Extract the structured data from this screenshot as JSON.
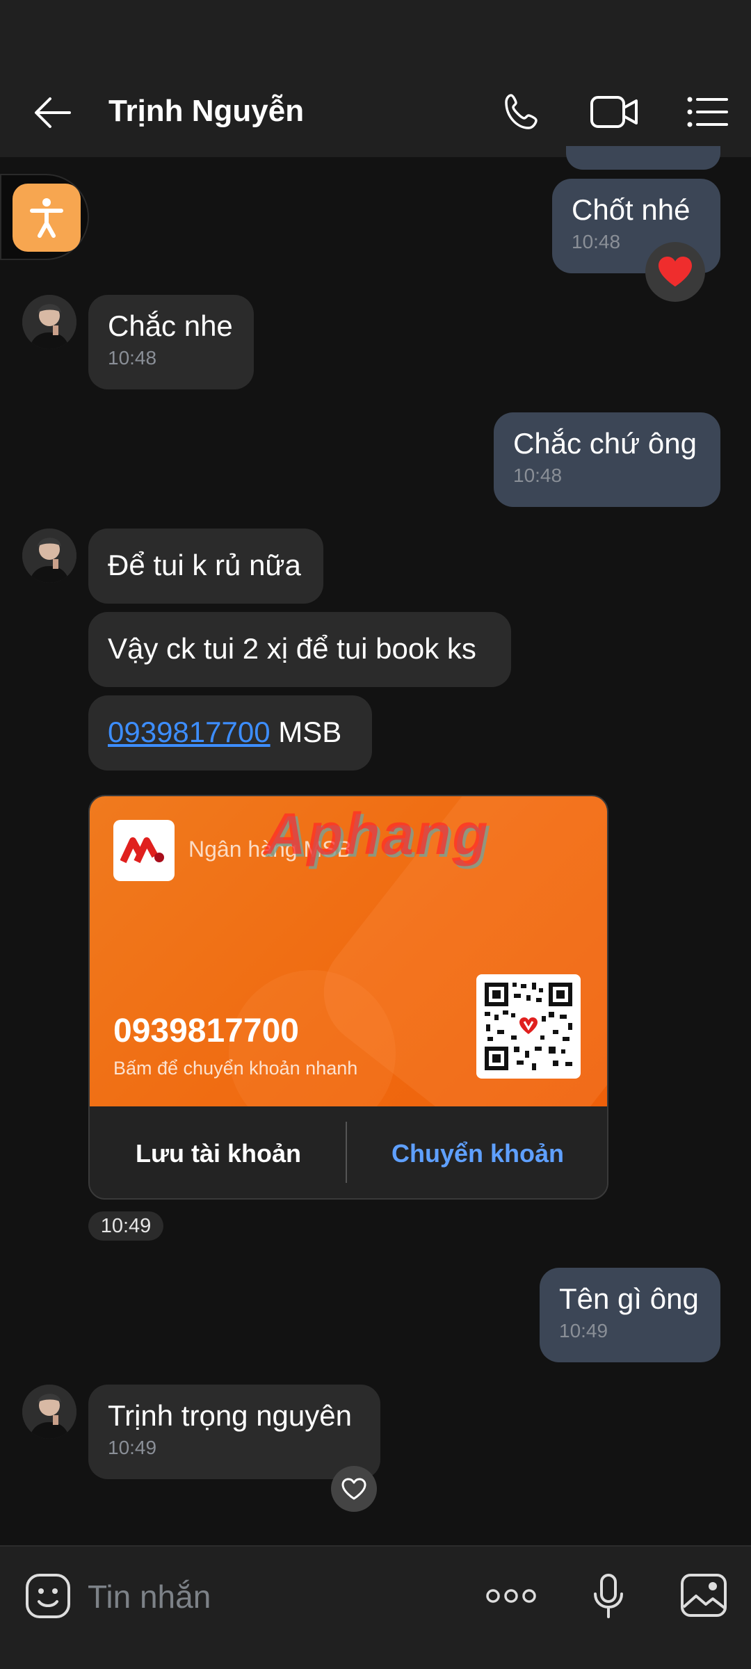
{
  "header": {
    "contact_name": "Trịnh Nguyễn",
    "icons": [
      "back-arrow-icon",
      "phone-icon",
      "video-camera-icon",
      "menu-list-icon"
    ]
  },
  "messages": [
    {
      "dir": "out",
      "text": "Chốt nhé",
      "time": "10:48",
      "reaction": "heart"
    },
    {
      "dir": "in",
      "text": "Chắc nhe",
      "time": "10:48"
    },
    {
      "dir": "out",
      "text": "Chắc chứ ông",
      "time": "10:48"
    },
    {
      "dir": "in",
      "text": "Để tui k rủ nữa"
    },
    {
      "dir": "in",
      "text": "Vậy ck tui 2 xị để tui book ks"
    },
    {
      "dir": "in",
      "link": "0939817700",
      "text_after_link": " MSB"
    },
    {
      "dir": "out",
      "text": "Tên gì ông",
      "time": "10:49"
    },
    {
      "dir": "in",
      "text": "Trịnh trọng nguyên",
      "time": "10:49",
      "reaction": "heart-outline"
    }
  ],
  "bank_card": {
    "bank_name": "Ngân hàng MSB",
    "account_number": "0939817700",
    "subtitle": "Bấm để chuyển khoản nhanh",
    "save_label": "Lưu tài khoản",
    "transfer_label": "Chuyển khoản",
    "watermark": "Aphang",
    "accent_color": "#f06a10",
    "link_color": "#5fa0ff"
  },
  "card_time": "10:49",
  "composer": {
    "placeholder": "Tin nhắn"
  },
  "colors": {
    "background": "#121212",
    "incoming_bubble": "#2b2b2b",
    "outgoing_bubble": "#3c4656",
    "link": "#3d8eff"
  }
}
